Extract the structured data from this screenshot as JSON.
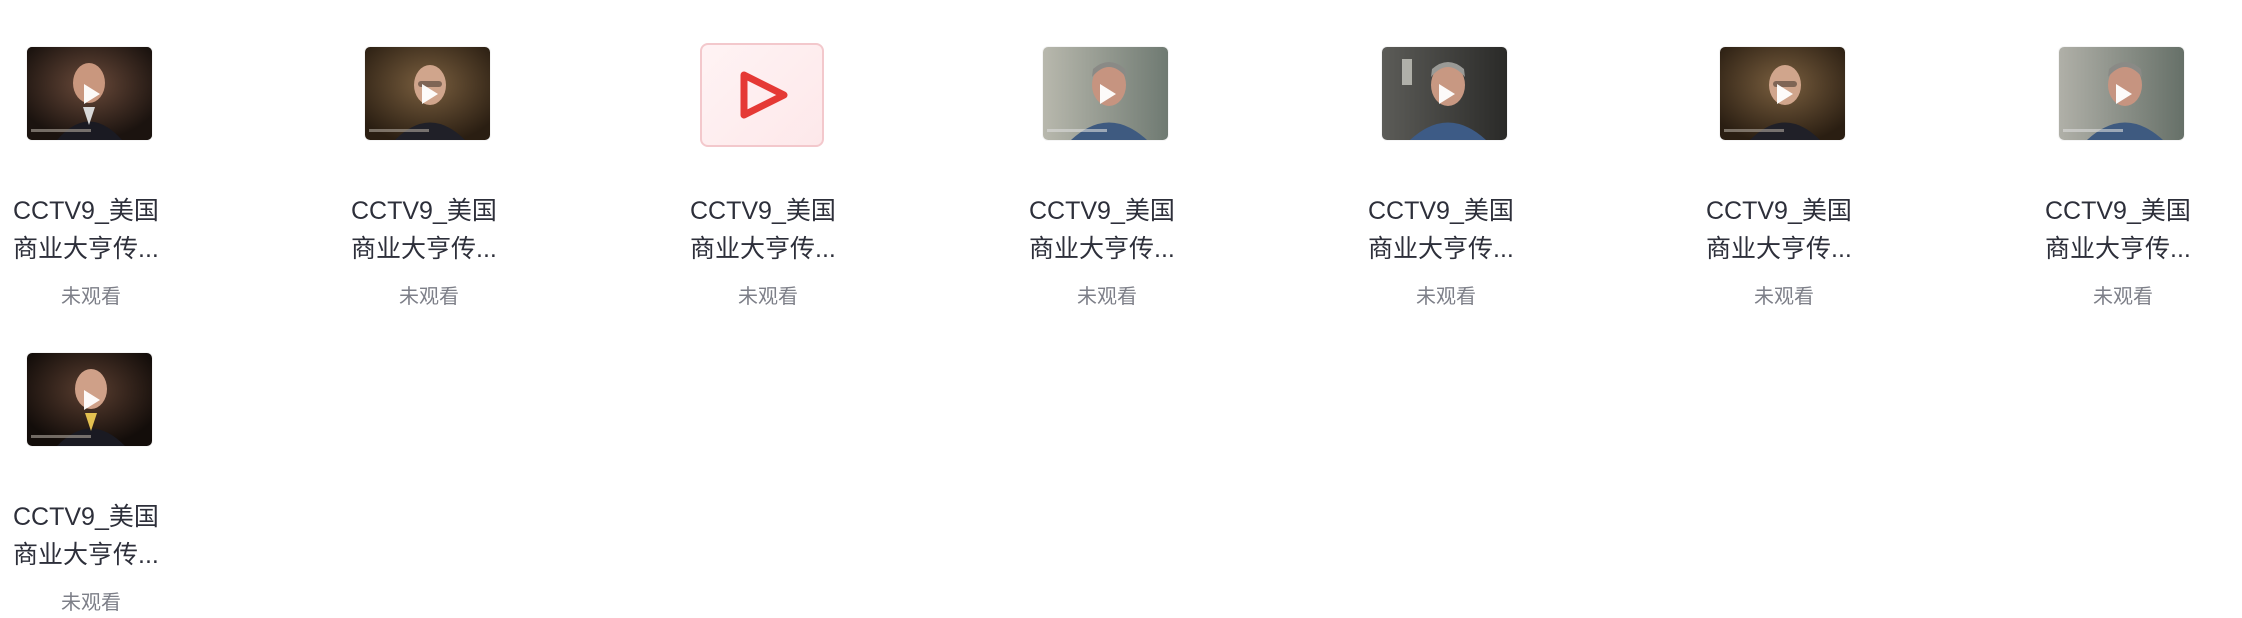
{
  "items": [
    {
      "title_line1": "CCTV9_美国",
      "title_line2": "商业大亨传...",
      "status": "未观看",
      "thumbnail": "video-thumb-dark-suit"
    },
    {
      "title_line1": "CCTV9_美国",
      "title_line2": "商业大亨传...",
      "status": "未观看",
      "thumbnail": "video-thumb-elder-glasses"
    },
    {
      "title_line1": "CCTV9_美国",
      "title_line2": "商业大亨传...",
      "status": "未观看",
      "thumbnail": "video-placeholder-play-icon"
    },
    {
      "title_line1": "CCTV9_美国",
      "title_line2": "商业大亨传...",
      "status": "未观看",
      "thumbnail": "video-thumb-gray-hair"
    },
    {
      "title_line1": "CCTV9_美国",
      "title_line2": "商业大亨传...",
      "status": "未观看",
      "thumbnail": "video-thumb-gray-hair"
    },
    {
      "title_line1": "CCTV9_美国",
      "title_line2": "商业大亨传...",
      "status": "未观看",
      "thumbnail": "video-thumb-elder-glasses"
    },
    {
      "title_line1": "CCTV9_美国",
      "title_line2": "商业大亨传...",
      "status": "未观看",
      "thumbnail": "video-thumb-gray-hair"
    },
    {
      "title_line1": "CCTV9_美国",
      "title_line2": "商业大亨传...",
      "status": "未观看",
      "thumbnail": "video-thumb-dark-suit"
    }
  ],
  "colors": {
    "title": "#2d2f3a",
    "status": "#7d7f88",
    "placeholder_play": "#e53935",
    "placeholder_border": "#f3c8cc"
  }
}
